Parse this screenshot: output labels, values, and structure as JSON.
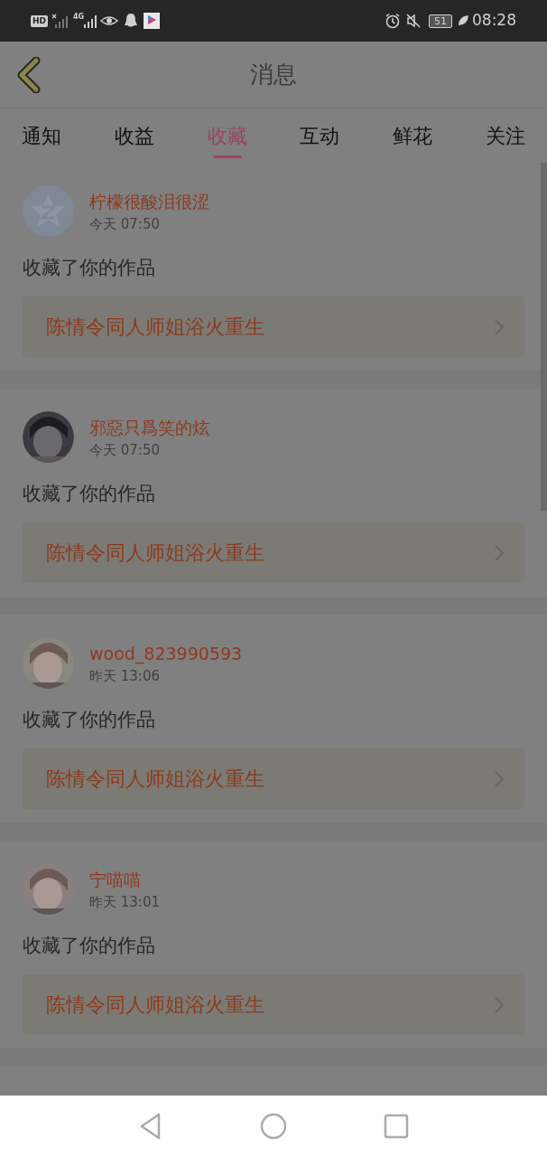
{
  "status_bar": {
    "hd": "HD",
    "network": "4G",
    "battery": "51",
    "time": "08:28"
  },
  "header": {
    "title": "消息"
  },
  "tabs": [
    {
      "label": "通知",
      "selected": false
    },
    {
      "label": "收益",
      "selected": false
    },
    {
      "label": "收藏",
      "selected": true
    },
    {
      "label": "互动",
      "selected": false
    },
    {
      "label": "鲜花",
      "selected": false
    },
    {
      "label": "关注",
      "selected": false
    }
  ],
  "messages": [
    {
      "user": "柠檬很酸泪很涩",
      "time": "今天 07:50",
      "avatar": {
        "kind": "default"
      },
      "text": "收藏了你的作品",
      "work": "陈情令同人师姐浴火重生"
    },
    {
      "user": "邪惡只爲笑的炫",
      "time": "今天 07:50",
      "text": "收藏了你的作品",
      "work": "陈情令同人师姐浴火重生"
    },
    {
      "user": "wood_823990593",
      "time": "昨天 13:06",
      "text": "收藏了你的作品",
      "work": "陈情令同人师姐浴火重生"
    },
    {
      "user": "宁喵喵",
      "time": "昨天 13:01",
      "text": "收藏了你的作品",
      "work": "陈情令同人师姐浴火重生"
    }
  ]
}
